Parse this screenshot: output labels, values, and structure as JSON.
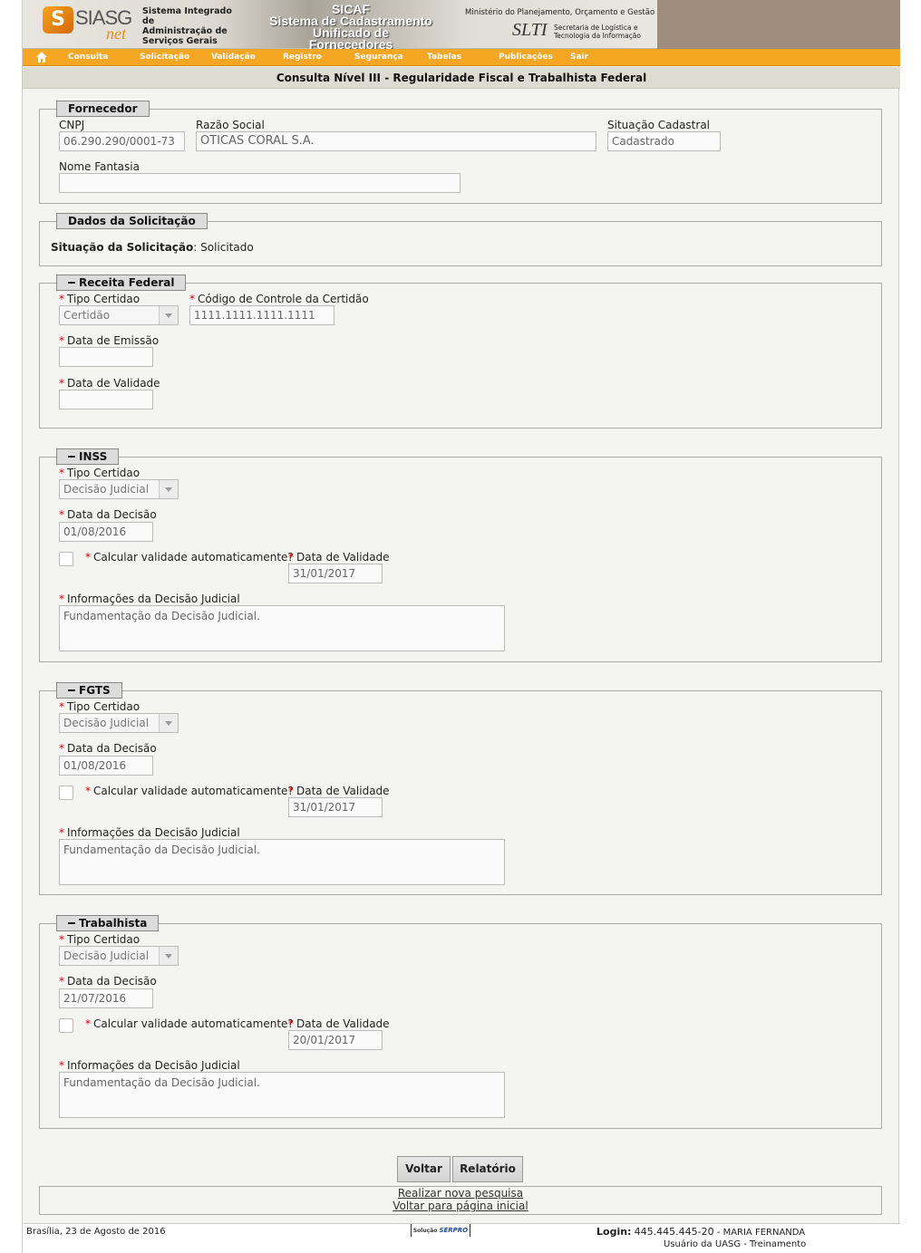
{
  "header": {
    "logo_text": "SIASG",
    "logo_sub": "net",
    "system_name_1": "Sistema Integrado de",
    "system_name_2": "Administração de",
    "system_name_3": "Serviços Gerais",
    "sicaf_title": "SICAF",
    "sicaf_sub_1": "Sistema de Cadastramento",
    "sicaf_sub_2": "Unificado de Fornecedores",
    "ministry": "Ministério do Planejamento, Orçamento e Gestão",
    "slti": "SLTI",
    "slti_txt_1": "Secretaria de Logística e",
    "slti_txt_2": "Tecnologia da Informação"
  },
  "nav": {
    "items": [
      "Consulta",
      "Solicitação",
      "Validação",
      "Registro",
      "Segurança",
      "Tabelas",
      "Publicações",
      "Sair"
    ],
    "color": "#f5a623"
  },
  "page_title": "Consulta Nível III - Regularidade Fiscal e Trabalhista Federal",
  "fornecedor": {
    "legend": "Fornecedor",
    "cnpj_label": "CNPJ",
    "cnpj_value": "06.290.290/0001-73",
    "razao_label": "Razão Social",
    "razao_value": "OTICAS CORAL S.A.",
    "situacao_label": "Situação Cadastral",
    "situacao_value": "Cadastrado",
    "fantasia_label": "Nome Fantasia",
    "fantasia_value": ""
  },
  "solicitacao": {
    "legend": "Dados da Solicitação",
    "label": "Situação da Solicitação",
    "value": ": Solicitado"
  },
  "receita": {
    "legend": "Receita Federal",
    "tipo_label": "Tipo Certidao",
    "tipo_value": "Certidão",
    "codigo_label": "Código de Controle da Certidão",
    "codigo_value": "1111.1111.1111.1111",
    "emissao_label": "Data de Emissão",
    "emissao_value": "",
    "validade_label": "Data de Validade",
    "validade_value": ""
  },
  "inss": {
    "legend": "INSS",
    "tipo_label": "Tipo Certidao",
    "tipo_value": "Decisão Judicial",
    "decisao_label": "Data da Decisão",
    "decisao_value": "01/08/2016",
    "calc_label": "Calcular validade automaticamente?",
    "validade_label": "Data de Validade",
    "validade_value": "31/01/2017",
    "info_label": "Informações da Decisão Judicial",
    "info_value": "Fundamentação da Decisão Judicial."
  },
  "fgts": {
    "legend": "FGTS",
    "tipo_label": "Tipo Certidao",
    "tipo_value": "Decisão Judicial",
    "decisao_label": "Data da Decisão",
    "decisao_value": "01/08/2016",
    "calc_label": "Calcular validade automaticamente?",
    "validade_label": "Data de Validade",
    "validade_value": "31/01/2017",
    "info_label": "Informações da Decisão Judicial",
    "info_value": "Fundamentação da Decisão Judicial."
  },
  "trabalhista": {
    "legend": "Trabalhista",
    "tipo_label": "Tipo Certidao",
    "tipo_value": "Decisão Judicial",
    "decisao_label": "Data da Decisão",
    "decisao_value": "21/07/2016",
    "calc_label": "Calcular validade automaticamente?",
    "validade_label": "Data de Validade",
    "validade_value": "20/01/2017",
    "info_label": "Informações da Decisão Judicial",
    "info_value": "Fundamentação da Decisão Judicial."
  },
  "required_mark": "*",
  "buttons": {
    "voltar": "Voltar",
    "relatorio": "Relatório"
  },
  "links": {
    "nova_pesquisa": "Realizar nova pesquisa",
    "pagina_inicial": "Voltar para página inicial"
  },
  "footer": {
    "date": "Brasília, 23 de Agosto de 2016",
    "serpro_prefix": "Solução",
    "serpro": "SERPRO",
    "login_label": "Login:",
    "login_cpf": "445.445.445-20",
    "login_name": "- MARIA FERNANDA",
    "user_role": "Usuário da UASG - Treinamento"
  }
}
